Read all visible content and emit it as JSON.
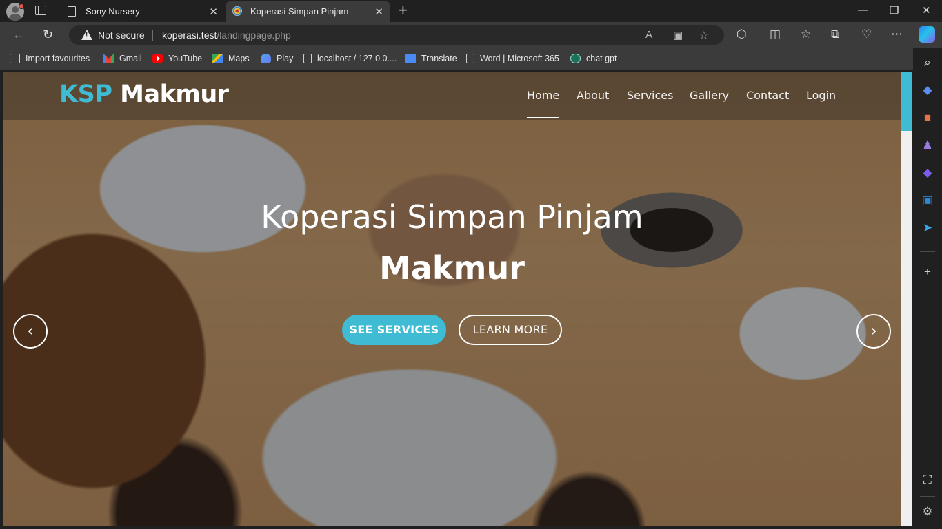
{
  "browser": {
    "tabs": [
      {
        "title": "Sony Nursery",
        "active": false
      },
      {
        "title": "Koperasi Simpan Pinjam",
        "active": true
      }
    ],
    "security_label": "Not secure",
    "url_host": "koperasi.test",
    "url_path": "/landingpage.php",
    "favourites": [
      {
        "label": "Import favourites",
        "icon": "import-icon"
      },
      {
        "label": "Gmail",
        "icon": "gmail-icon"
      },
      {
        "label": "YouTube",
        "icon": "youtube-icon"
      },
      {
        "label": "Maps",
        "icon": "maps-icon"
      },
      {
        "label": "Play",
        "icon": "play-icon"
      },
      {
        "label": "localhost / 127.0.0....",
        "icon": "page-icon"
      },
      {
        "label": "Translate",
        "icon": "translate-icon"
      },
      {
        "label": "Word | Microsoft 365",
        "icon": "page-icon"
      },
      {
        "label": "chat gpt",
        "icon": "chatgpt-icon"
      }
    ]
  },
  "site": {
    "logo_ksp": "KSP",
    "logo_name": "Makmur",
    "nav": [
      "Home",
      "About",
      "Services",
      "Gallery",
      "Contact",
      "Login"
    ],
    "active_nav": "Home",
    "hero_title": "Koperasi Simpan Pinjam",
    "hero_subtitle": "Makmur",
    "btn_primary": "SEE SERVICES",
    "btn_secondary": "LEARN MORE",
    "prev_glyph": "‹",
    "next_glyph": "›"
  },
  "colors": {
    "accent": "#3fbbd3",
    "browser_bg": "#202020",
    "toolbar_bg": "#3b3b3b"
  }
}
